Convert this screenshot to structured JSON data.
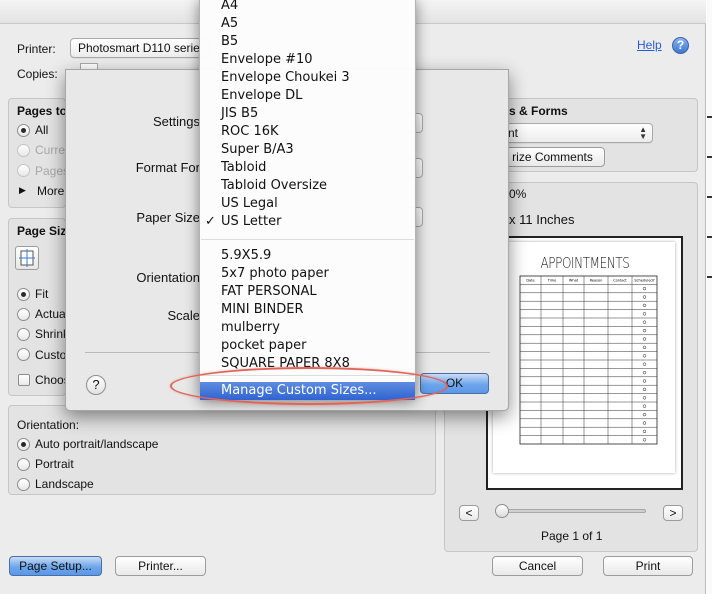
{
  "print_dialog": {
    "printer_label": "Printer:",
    "printer_value": "Photosmart D110 serie",
    "copies_label": "Copies:",
    "help_link": "Help",
    "help_icon": "?",
    "pages_title": "Pages to",
    "pages_all": "All",
    "pages_current": "Curre",
    "pages_pages": "Pages",
    "pages_more": "More",
    "page_size_title": "Page Siz",
    "scaling_fit": "Fit",
    "scaling_actual": "Actua",
    "scaling_shrink": "Shrink",
    "scaling_custom": "Custo",
    "choose_checkbox": "Choos",
    "comments_title": "s & Forms",
    "comments_value": "nt",
    "summarize_comments": "rize Comments",
    "zoom_label": "0%",
    "paper_dims": "x 11 Inches",
    "preview_title": "APPOINTMENTS",
    "preview_columns": [
      "Date",
      "Time",
      "What",
      "Reason",
      "Contact",
      "Scheduled?"
    ],
    "page_indicator": "Page 1 of 1",
    "prev_button": "<",
    "next_button": ">",
    "orientation_title": "Orientation:",
    "orientation_auto": "Auto portrait/landscape",
    "orientation_portrait": "Portrait",
    "orientation_landscape": "Landscape",
    "page_setup_button": "Page Setup...",
    "printer_button": "Printer...",
    "cancel_button": "Cancel",
    "print_button": "Print"
  },
  "page_setup": {
    "settings_label": "Settings",
    "format_for_label": "Format For",
    "paper_size_label": "Paper Size",
    "orientation_label": "Orientation",
    "scale_label": "Scale",
    "help_icon": "?",
    "ok_button": "OK"
  },
  "paper_menu": {
    "standard_sizes": [
      "A4",
      "A5",
      "B5",
      "Envelope #10",
      "Envelope Choukei 3",
      "Envelope DL",
      "JIS B5",
      "ROC 16K",
      "Super B/A3",
      "Tabloid",
      "Tabloid Oversize",
      "US Legal",
      "US Letter"
    ],
    "selected": "US Letter",
    "check_mark": "✓",
    "custom_sizes": [
      "5.9X5.9",
      "5x7 photo paper",
      "FAT PERSONAL",
      "MINI BINDER",
      "mulberry",
      "pocket paper",
      "SQUARE PAPER 8X8"
    ],
    "manage_custom": "Manage Custom Sizes..."
  },
  "colors": {
    "highlight": "#3a6fd6",
    "annotation": "#e06458",
    "link": "#2a5bd7"
  }
}
